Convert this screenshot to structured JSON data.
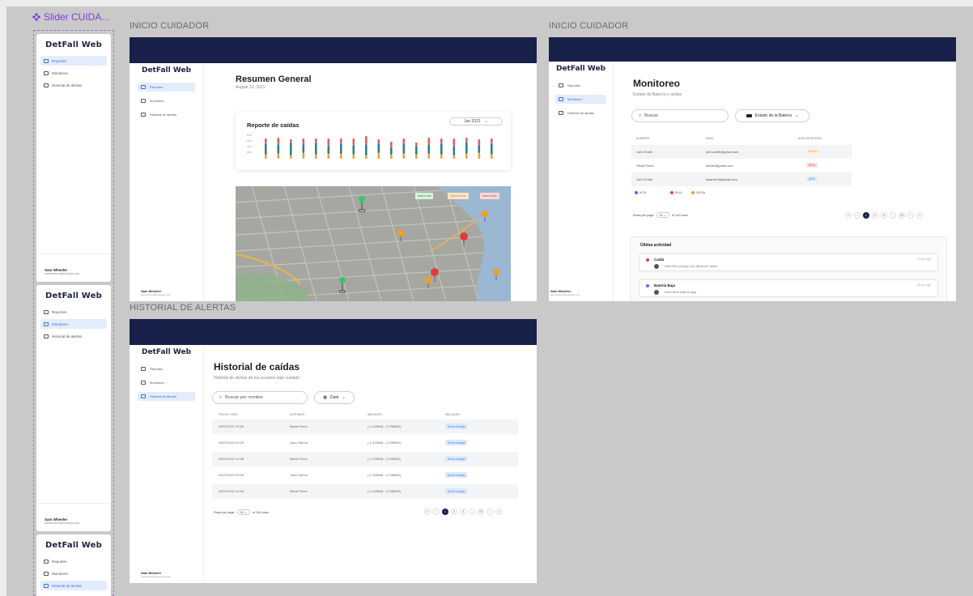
{
  "canvas": {
    "component": {
      "name": "Slider CUIDA...",
      "accent": "#7b3fe4"
    },
    "frame_labels": [
      "INICIO CUIDADOR",
      "INICIO CUIDADOR",
      "HISTORIAL DE ALERTAS"
    ]
  },
  "app": {
    "logo": "DetFall Web",
    "nav": [
      "Reportes",
      "Monitoreo",
      "Historial de alertas"
    ],
    "user": {
      "name": "Sam Wheeler",
      "email": "samwheeler@example.com"
    },
    "colors": {
      "topbar": "#17214a",
      "active_nav_bg": "#e3ecfb",
      "active_nav_text": "#3d6fd8"
    }
  },
  "reportes": {
    "title": "Resumen General",
    "date": "August 13, 2021",
    "chart_title": "Reporte de caídas",
    "month_select": "Jun 2021",
    "y_ticks": [
      "80%",
      "60%",
      "40%",
      "20%"
    ],
    "map_badges": [
      "Batería Alta",
      "Batería Media",
      "Batería Baja"
    ]
  },
  "monitoreo": {
    "title": "Monitoreo",
    "subtitle": "Estado de Batería y caídas",
    "search_placeholder": "Buscar",
    "battery_filter": "Estado de la Batería",
    "columns": [
      "NOMBRES",
      "EMAIL",
      "NIVEL DE BATERÍA"
    ],
    "rows": [
      {
        "name": "John Smith",
        "email": "john.smith@gmail.com",
        "level": "MEDIA",
        "color": "#f0a020",
        "bg": "#fdf1dc"
      },
      {
        "name": "Olivia Perez",
        "email": "olivian@gmail.com",
        "level": "BAJA",
        "color": "#e04545",
        "bg": "#fbe1e1"
      },
      {
        "name": "John Smith",
        "email": "dwarren3@gmail.com",
        "level": "ALTA",
        "color": "#3a74d4",
        "bg": "#dde9fb"
      }
    ],
    "legend": [
      "ALTA",
      "BAJA",
      "MEDIA"
    ],
    "rows_per_page_label": "Rows per page",
    "rows_per_page": "10",
    "total_rows": "of 140 rows",
    "pages": [
      "«",
      "‹",
      "1",
      "2",
      "3",
      "...",
      "10",
      "›",
      "»"
    ],
    "activity_title": "Última actividad",
    "activity": [
      {
        "title": "Caída",
        "desc": "Olivia Ben produjo una alerta de Caída.",
        "time": "10 min ago",
        "color": "#e04545"
      },
      {
        "title": "Batería Baja",
        "desc": "Olivia tiene batería baja.",
        "time": "45 min ago",
        "color": "#8a5be0"
      }
    ]
  },
  "historial": {
    "title": "Historial de caídas",
    "subtitle": "Historial de alertas de los usuarios bajo cuidado",
    "search_placeholder": "Buscar por nombre",
    "date_filter": "Date",
    "columns": [
      "FECHA Y HORA",
      "ALERTANTE",
      "UBICACIÓN",
      "UBICACIÓN"
    ],
    "rows": [
      {
        "date": "03/07/2022 14:00",
        "who": "María Pérez",
        "loc": "(-2.128946, -2.298946)",
        "link": "Ver en el mapa"
      },
      {
        "date": "03/07/2022 09:15",
        "who": "Juan García",
        "loc": "(-2.128946, -2.298946)",
        "link": "Ver en el mapa"
      },
      {
        "date": "03/07/2022 14:05",
        "who": "María Pérez",
        "loc": "(-2.128946, -2.298946)",
        "link": "Ver en el mapa"
      },
      {
        "date": "01/07/2022 09:15",
        "who": "Juan García",
        "loc": "(-2.128946, -2.298946)",
        "link": "Ver en el mapa"
      },
      {
        "date": "03/07/2022 14:00",
        "who": "María Pérez",
        "loc": "(-2.128946, -2.298946)",
        "link": "Ver en el mapa"
      }
    ],
    "rows_per_page_label": "Rows per page",
    "rows_per_page": "10",
    "total_rows": "of 140 rows",
    "pages": [
      "«",
      "‹",
      "1",
      "2",
      "3",
      "...",
      "10",
      "›",
      "»"
    ]
  }
}
